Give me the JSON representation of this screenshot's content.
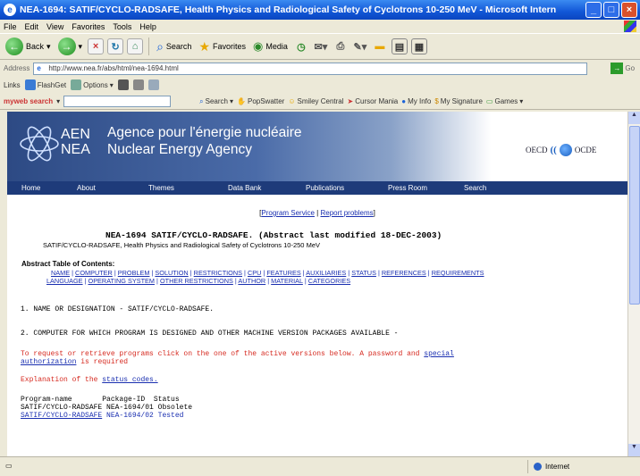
{
  "window": {
    "title": "NEA-1694: SATIF/CYCLO-RADSAFE, Health Physics and Radiological Safety of Cyclotrons 10-250 MeV - Microsoft Internet Explorer",
    "icon": "ie-icon",
    "controls": {
      "minimize": "_",
      "maximize": "□",
      "close": "×"
    }
  },
  "menu": [
    "File",
    "Edit",
    "View",
    "Favorites",
    "Tools",
    "Help"
  ],
  "toolbar": {
    "back": "Back",
    "search": "Search",
    "favorites": "Favorites",
    "media": "Media"
  },
  "address": {
    "label": "Address",
    "url": "http://www.nea.fr/abs/html/nea-1694.html",
    "go": "Go"
  },
  "links_toolbar": {
    "links": "Links",
    "flashget": "FlashGet",
    "options": "Options"
  },
  "search_toolbar": {
    "brand": "myweb search",
    "search": "Search",
    "items": [
      "PopSwatter",
      "Smiley Central",
      "Cursor Mania",
      "My Info",
      "My Signature",
      "Games"
    ]
  },
  "nea": {
    "abbr_top": "AEN",
    "abbr_bottom": "NEA",
    "name_fr": "Agence pour l'énergie nucléaire",
    "name_en": "Nuclear Energy Agency",
    "oecd_left": "OECD",
    "oecd_right": "OCDE"
  },
  "nav": [
    "Home",
    "About",
    "Themes",
    "Data Bank",
    "Publications",
    "Press Room",
    "Search"
  ],
  "page": {
    "top_links": [
      "Program Service",
      "Report problems"
    ],
    "heading": "NEA-1694 SATIF/CYCLO-RADSAFE. (Abstract last modified 18-DEC-2003)",
    "subheading": "SATIF/CYCLO-RADSAFE, Health Physics and Radiological Safety of Cyclotrons 10-250 MeV",
    "toc_title": "Abstract Table of Contents:",
    "toc_line1": [
      "NAME",
      "COMPUTER",
      "PROBLEM",
      "SOLUTION",
      "RESTRICTIONS",
      "CPU",
      "FEATURES",
      "AUXILIARIES",
      "STATUS",
      "REFERENCES",
      "REQUIREMENTS"
    ],
    "toc_line2": [
      "LANGUAGE",
      "OPERATING SYSTEM",
      "OTHER RESTRICTIONS",
      "AUTHOR",
      "MATERIAL",
      "CATEGORIES"
    ],
    "section1": "1. NAME OR DESIGNATION - SATIF/CYCLO-RADSAFE.",
    "section2": "2. COMPUTER FOR WHICH PROGRAM IS DESIGNED AND OTHER MACHINE VERSION PACKAGES AVAILABLE -",
    "request_text": "To request or retrieve programs click on the one of the active versions below. A password and",
    "request_link": "special",
    "request_link2": "authorization",
    "request_tail": "is required",
    "explain_text": "Explanation of the",
    "explain_link": "status codes.",
    "table_headers": [
      "Program-name",
      "Package-ID",
      "Status"
    ],
    "table_rows": [
      {
        "name": "SATIF/CYCLO-RADSAFE",
        "id": "NEA-1694/01",
        "status": "Obsolete",
        "active": false
      },
      {
        "name": "SATIF/CYCLO-RADSAFE",
        "id": "NEA-1694/02",
        "status": "Tested",
        "active": true
      }
    ]
  },
  "statusbar": {
    "text": "",
    "zone": "Internet"
  }
}
